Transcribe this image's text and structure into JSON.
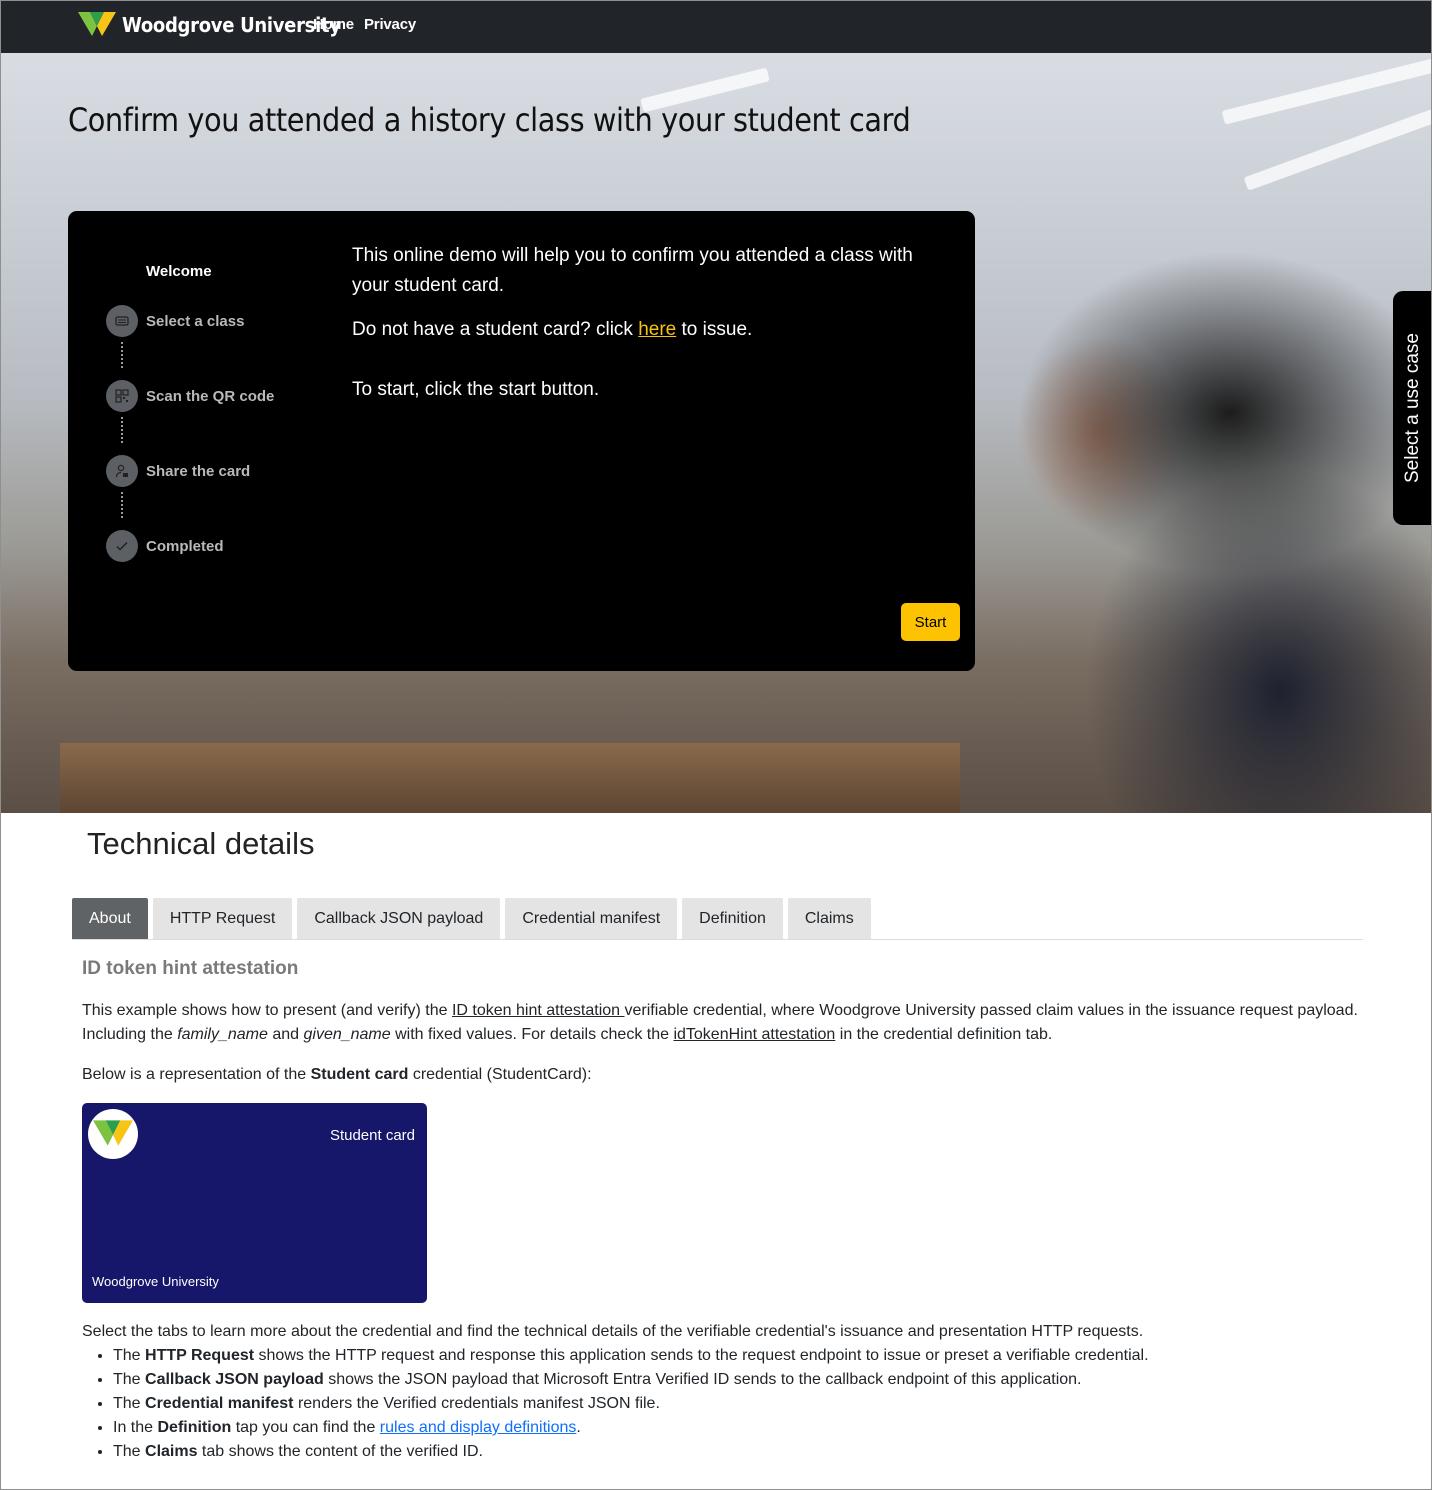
{
  "navbar": {
    "brand": "Woodgrove University",
    "links": [
      "Home",
      "Privacy"
    ]
  },
  "hero": {
    "title": "Confirm you attended a history class with your student card"
  },
  "wizard": {
    "steps": [
      {
        "label": "Welcome",
        "icon": "none",
        "active": true
      },
      {
        "label": "Select a class",
        "icon": "list-icon",
        "active": false
      },
      {
        "label": "Scan the QR code",
        "icon": "qr-code-icon",
        "active": false
      },
      {
        "label": "Share the card",
        "icon": "user-share-icon",
        "active": false
      },
      {
        "label": "Completed",
        "icon": "check-icon",
        "active": false
      }
    ],
    "intro": "This online demo will help you to confirm you attended a class with your student card.",
    "no_card_prefix": "Do not have a student card? click ",
    "no_card_link": "here",
    "no_card_suffix": " to issue.",
    "start_hint": "To start, click the start button.",
    "start_button": "Start"
  },
  "side_tab": {
    "label": "Select a use case"
  },
  "technical": {
    "title": "Technical details",
    "tabs": [
      "About",
      "HTTP Request",
      "Callback JSON payload",
      "Credential manifest",
      "Definition",
      "Claims"
    ],
    "active_tab": "About",
    "about": {
      "heading": "ID token hint attestation",
      "p1_a": "This example shows how to present (and verify) the ",
      "p1_link": "ID token hint attestation ",
      "p1_b": "verifiable credential, where Woodgrove University passed claim values in the issuance request payload. Including the ",
      "p1_em1": "family_name",
      "p1_c": " and ",
      "p1_em2": "given_name",
      "p1_d": " with fixed values. For details check the ",
      "p1_link2": "idTokenHint attestation",
      "p1_e": " in the credential definition tab.",
      "p2_a": "Below is a representation of the ",
      "p2_strong": "Student card",
      "p2_b": " credential (StudentCard):"
    },
    "card": {
      "title": "Student card",
      "issuer": "Woodgrove University",
      "background": "#16166a"
    },
    "tabs_intro": "Select the tabs to learn more about the credential and find the technical details of the verifiable credential's issuance and presentation HTTP requests.",
    "bullets": [
      {
        "a": "The ",
        "strong": "HTTP Request",
        "b": " shows the HTTP request and response this application sends to the request endpoint to issue or preset a verifiable credential."
      },
      {
        "a": "The ",
        "strong": "Callback JSON payload",
        "b": " shows the JSON payload that Microsoft Entra Verified ID sends to the callback endpoint of this application."
      },
      {
        "a": "The ",
        "strong": "Credential manifest",
        "b": " renders the Verified credentials manifest JSON file."
      },
      {
        "a": "In the ",
        "strong": "Definition",
        "b": " tap you can find the ",
        "link": "rules and display definitions",
        "c": "."
      },
      {
        "a": "The ",
        "strong": "Claims",
        "b": " tab shows the content of the verified ID."
      }
    ]
  },
  "colors": {
    "navbar": "#212529",
    "accent": "#fdc300",
    "link_accent": "#f8c212",
    "active_tab": "#5f6366"
  }
}
